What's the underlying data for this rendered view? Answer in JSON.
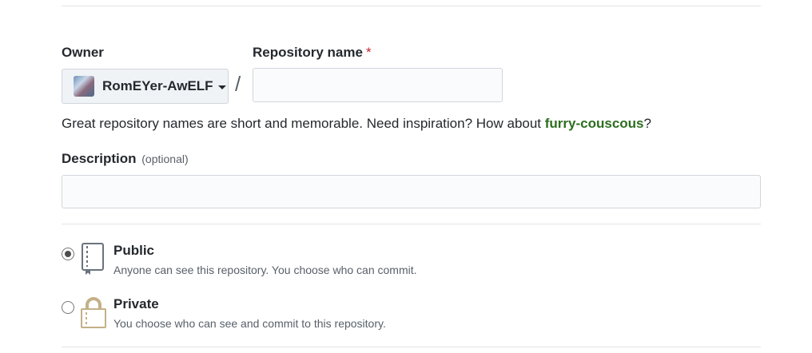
{
  "owner": {
    "label": "Owner",
    "selected": "RomEYer-AwELF"
  },
  "repository": {
    "label": "Repository name",
    "required_mark": "*",
    "separator": "/",
    "value": "",
    "hint_prefix": "Great repository names are short and memorable. Need inspiration? How about ",
    "suggestion": "furry-couscous",
    "hint_suffix": "?"
  },
  "description": {
    "label": "Description",
    "optional": "(optional)",
    "value": ""
  },
  "visibility": {
    "selected": "public",
    "options": [
      {
        "key": "public",
        "title": "Public",
        "desc": "Anyone can see this repository. You choose who can commit.",
        "icon": "book-icon"
      },
      {
        "key": "private",
        "title": "Private",
        "desc": "You choose who can see and commit to this repository.",
        "icon": "lock-icon"
      }
    ]
  },
  "colors": {
    "suggestion": "#2c6e1f",
    "required": "#cb2431",
    "lock": "#c4b087"
  }
}
